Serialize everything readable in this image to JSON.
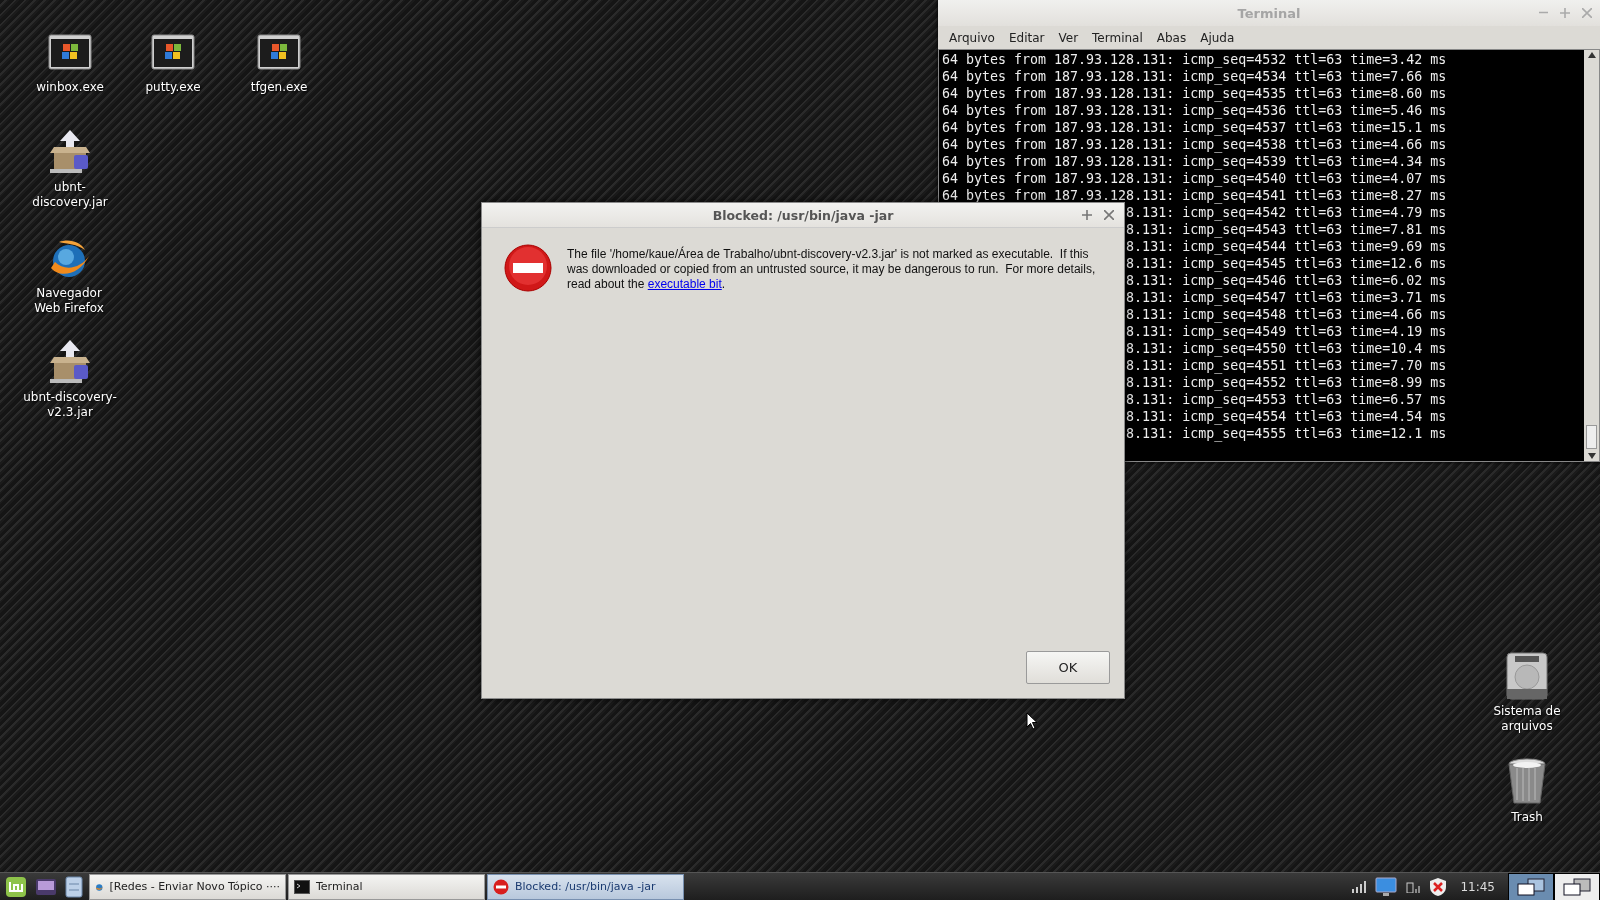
{
  "desktop": {
    "icons": [
      {
        "label": "winbox.exe",
        "kind": "exe"
      },
      {
        "label": "putty.exe",
        "kind": "exe"
      },
      {
        "label": "tfgen.exe",
        "kind": "exe"
      },
      {
        "label": "ubnt-discovery.jar",
        "kind": "jar"
      },
      {
        "label": "Navegador Web Firefox",
        "kind": "browser"
      },
      {
        "label": "ubnt-discovery-v2.3.jar",
        "kind": "jar"
      },
      {
        "label": "Sistema de arquivos",
        "kind": "drive"
      },
      {
        "label": "Trash",
        "kind": "trash"
      }
    ]
  },
  "terminal": {
    "title": "Terminal",
    "menu": [
      "Arquivo",
      "Editar",
      "Ver",
      "Terminal",
      "Abas",
      "Ajuda"
    ],
    "lines": [
      {
        "text": "64 bytes from 187.93.128.131: icmp_seq=4532 ttl=63 time=3.42 ms",
        "kind": "full"
      },
      {
        "text": "64 bytes from 187.93.128.131: icmp_seq=4534 ttl=63 time=7.66 ms",
        "kind": "full"
      },
      {
        "text": "64 bytes from 187.93.128.131: icmp_seq=4535 ttl=63 time=8.60 ms",
        "kind": "full"
      },
      {
        "text": "64 bytes from 187.93.128.131: icmp_seq=4536 ttl=63 time=5.46 ms",
        "kind": "full"
      },
      {
        "text": "64 bytes from 187.93.128.131: icmp_seq=4537 ttl=63 time=15.1 ms",
        "kind": "full"
      },
      {
        "text": "64 bytes from 187.93.128.131: icmp_seq=4538 ttl=63 time=4.66 ms",
        "kind": "full"
      },
      {
        "text": "64 bytes from 187.93.128.131: icmp_seq=4539 ttl=63 time=4.34 ms",
        "kind": "full"
      },
      {
        "text": "64 bytes from 187.93.128.131: icmp_seq=4540 ttl=63 time=4.07 ms",
        "kind": "full"
      },
      {
        "text": "64 bytes from 187.93.128.131: icmp_seq=4541 ttl=63 time=8.27 ms",
        "kind": "full"
      },
      {
        "text": "8.131: icmp_seq=4542 ttl=63 time=4.79 ms",
        "kind": "covered"
      },
      {
        "text": "8.131: icmp_seq=4543 ttl=63 time=7.81 ms",
        "kind": "covered"
      },
      {
        "text": "8.131: icmp_seq=4544 ttl=63 time=9.69 ms",
        "kind": "covered"
      },
      {
        "text": "8.131: icmp_seq=4545 ttl=63 time=12.6 ms",
        "kind": "covered"
      },
      {
        "text": "8.131: icmp_seq=4546 ttl=63 time=6.02 ms",
        "kind": "covered"
      },
      {
        "text": "8.131: icmp_seq=4547 ttl=63 time=3.71 ms",
        "kind": "covered"
      },
      {
        "text": "8.131: icmp_seq=4548 ttl=63 time=4.66 ms",
        "kind": "covered"
      },
      {
        "text": "8.131: icmp_seq=4549 ttl=63 time=4.19 ms",
        "kind": "covered"
      },
      {
        "text": "8.131: icmp_seq=4550 ttl=63 time=10.4 ms",
        "kind": "covered"
      },
      {
        "text": "8.131: icmp_seq=4551 ttl=63 time=7.70 ms",
        "kind": "covered"
      },
      {
        "text": "8.131: icmp_seq=4552 ttl=63 time=8.99 ms",
        "kind": "covered"
      },
      {
        "text": "8.131: icmp_seq=4553 ttl=63 time=6.57 ms",
        "kind": "covered"
      },
      {
        "text": "8.131: icmp_seq=4554 ttl=63 time=4.54 ms",
        "kind": "covered"
      },
      {
        "text": "8.131: icmp_seq=4555 ttl=63 time=12.1 ms",
        "kind": "covered"
      }
    ]
  },
  "dialog": {
    "title": "Blocked: /usr/bin/java -jar",
    "message": {
      "before": "The file '/home/kaue/Área de Trabalho/ubnt-discovery-v2.3.jar' is not marked as executable.  If this was downloaded or copied from an untrusted source, it may be dangerous to run.  For more details, read about the ",
      "link": "executable bit",
      "after": "."
    },
    "button": "OK"
  },
  "taskbar": {
    "launchers": [
      {
        "kind": "menu"
      },
      {
        "kind": "media"
      },
      {
        "kind": "files"
      }
    ],
    "tasks": [
      {
        "label": "[Redes - Enviar Novo Tópico ····",
        "kind": "browser",
        "selected": false
      },
      {
        "label": "Terminal",
        "kind": "terminal",
        "selected": false
      },
      {
        "label": "Blocked: /usr/bin/java -jar",
        "kind": "error",
        "selected": true
      }
    ],
    "clock": "11:45",
    "workspaces": [
      {
        "selected": true
      },
      {
        "selected": false
      }
    ]
  }
}
